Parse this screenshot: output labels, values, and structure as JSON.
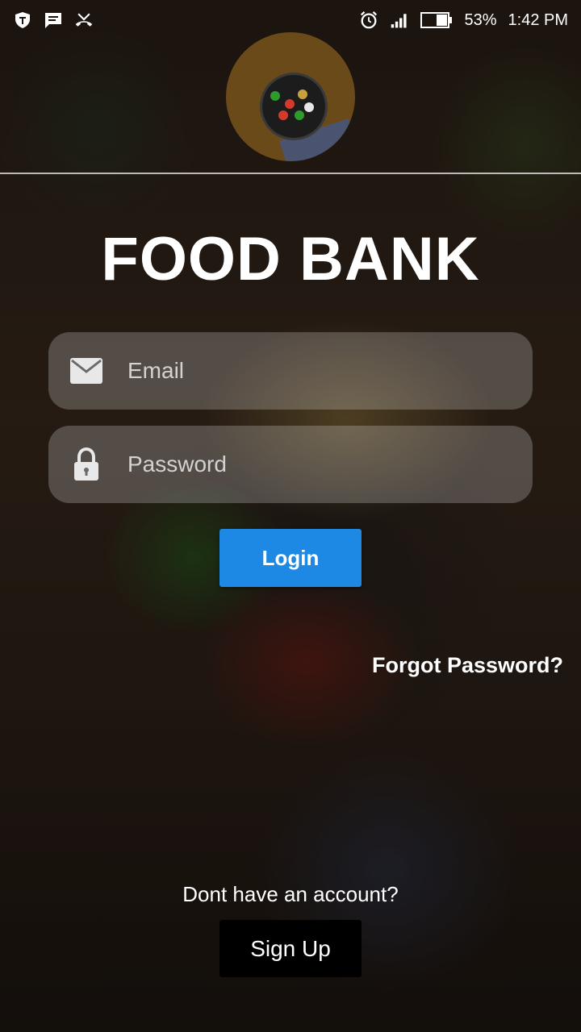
{
  "status_bar": {
    "battery_percent": "53%",
    "time": "1:42 PM",
    "icons_left": [
      "shield-app-icon",
      "message-icon",
      "missed-call-icon"
    ],
    "icons_right": [
      "alarm-icon",
      "signal-icon",
      "battery-icon"
    ]
  },
  "app": {
    "title": "FOOD BANK"
  },
  "login_form": {
    "email_placeholder": "Email",
    "password_placeholder": "Password",
    "login_label": "Login",
    "forgot_password": "Forgot Password?"
  },
  "signup": {
    "prompt": "Dont have an account?",
    "button_label": "Sign Up"
  },
  "colors": {
    "login_button": "#1e88e5",
    "signup_button": "#000000",
    "field_background": "rgba(255,255,255,0.22)"
  }
}
